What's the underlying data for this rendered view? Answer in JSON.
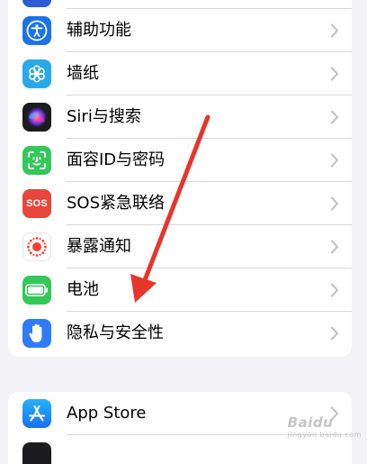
{
  "settings": {
    "group1": {
      "items": [
        {
          "label": "辅助功能",
          "icon": "accessibility-icon",
          "color": "#1a73e8"
        },
        {
          "label": "墙纸",
          "icon": "wallpaper-flower-icon",
          "color": "#2aa9e8"
        },
        {
          "label": "Siri与搜索",
          "icon": "siri-icon",
          "color": "#1c1c1e"
        },
        {
          "label": "面容ID与密码",
          "icon": "face-id-icon",
          "color": "#34c759"
        },
        {
          "label": "SOS紧急联络",
          "icon": "sos-icon",
          "color": "#e8453c"
        },
        {
          "label": "暴露通知",
          "icon": "exposure-notification-icon",
          "color": "#ffffff"
        },
        {
          "label": "电池",
          "icon": "battery-icon",
          "color": "#34c759"
        },
        {
          "label": "隐私与安全性",
          "icon": "privacy-hand-icon",
          "color": "#2f7cf6"
        }
      ]
    },
    "group2": {
      "items": [
        {
          "label": "App Store",
          "icon": "app-store-icon",
          "color": "#1a8cf7"
        }
      ]
    }
  },
  "sos_icon_text": "SOS",
  "watermark": {
    "text": "Baidu",
    "sub": "jingyan.baidu.com"
  },
  "colors": {
    "background": "#f2f2f7",
    "arrow": "#e8352c"
  }
}
